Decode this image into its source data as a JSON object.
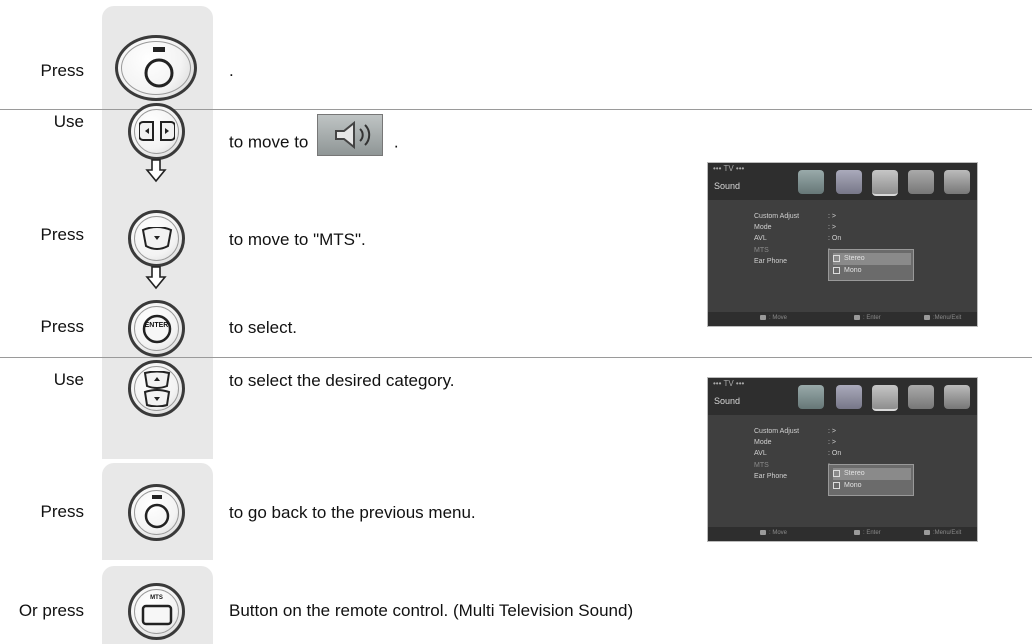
{
  "steps": [
    {
      "verb": "Press",
      "text": ".",
      "button": "menu-button"
    },
    {
      "verb": "Use",
      "text": "to move to",
      "text_after": ".",
      "button": "left-right-button"
    },
    {
      "verb": "Press",
      "text": "to move to  \"MTS\".",
      "button": "down-button"
    },
    {
      "verb": "Press",
      "text": "to select.",
      "button": "enter-button",
      "button_label": "ENTER"
    },
    {
      "verb": "Use",
      "text": "to select the desired category.",
      "button": "up-down-button"
    },
    {
      "verb": "Press",
      "text": "to go back to the previous menu.",
      "button": "menu-button"
    },
    {
      "verb": "Or press",
      "text": "Button on the remote control. (Multi Television Sound)",
      "button": "mts-button",
      "button_label": "MTS"
    }
  ],
  "osd": {
    "title": "••• TV •••",
    "section": "Sound",
    "rows": [
      {
        "label": "Custom Adjust",
        "value": ": >"
      },
      {
        "label": "Mode",
        "value": ": >"
      },
      {
        "label": "AVL",
        "value": ": On"
      },
      {
        "label": "MTS",
        "value": ":"
      },
      {
        "label": "Ear Phone",
        "value": ":"
      }
    ],
    "popup_options": [
      "Stereo",
      "Mono"
    ],
    "popup_selected": "Stereo",
    "footer": {
      "move": ": Move",
      "enter": ": Enter",
      "exit": ":Menu/Exit"
    }
  }
}
